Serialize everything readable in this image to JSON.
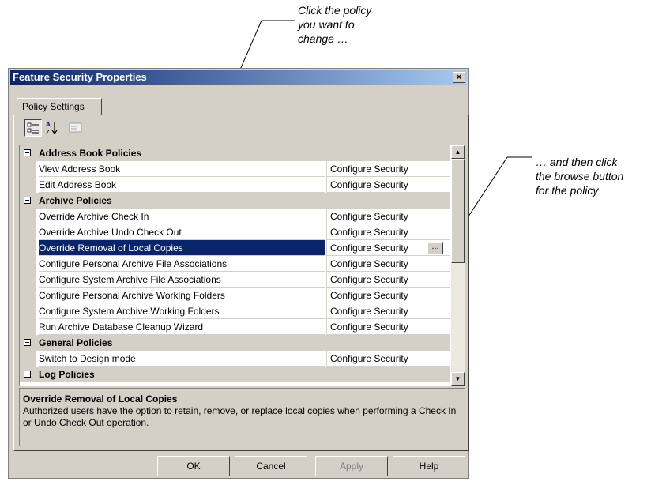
{
  "callouts": {
    "top": "Click the policy\nyou want to\nchange …",
    "right": "… and then click\nthe browse button\nfor the policy"
  },
  "window": {
    "title": "Feature Security Properties",
    "close": "×",
    "tab": "Policy Settings"
  },
  "toolbar": {
    "icons": [
      "categorized-icon",
      "alphabetical-sort-icon",
      "property-pages-icon"
    ],
    "alpha_glyph": "A Z"
  },
  "grid": {
    "rows": [
      {
        "type": "category",
        "name": "Address Book Policies"
      },
      {
        "type": "item",
        "name": "View Address Book",
        "value": "Configure Security"
      },
      {
        "type": "item",
        "name": "Edit Address Book",
        "value": "Configure Security"
      },
      {
        "type": "category",
        "name": "Archive Policies"
      },
      {
        "type": "item",
        "name": "Override Archive Check In",
        "value": "Configure Security"
      },
      {
        "type": "item",
        "name": "Override Archive Undo Check Out",
        "value": "Configure Security"
      },
      {
        "type": "item",
        "name": "Override Removal of Local Copies",
        "value": "Configure Security",
        "selected": true
      },
      {
        "type": "item",
        "name": "Configure Personal Archive File Associations",
        "value": "Configure Security"
      },
      {
        "type": "item",
        "name": "Configure System Archive File Associations",
        "value": "Configure Security"
      },
      {
        "type": "item",
        "name": "Configure Personal Archive Working Folders",
        "value": "Configure Security"
      },
      {
        "type": "item",
        "name": "Configure System Archive Working Folders",
        "value": "Configure Security"
      },
      {
        "type": "item",
        "name": "Run Archive Database Cleanup Wizard",
        "value": "Configure Security"
      },
      {
        "type": "category",
        "name": "General Policies"
      },
      {
        "type": "item",
        "name": "Switch to Design mode",
        "value": "Configure Security"
      },
      {
        "type": "category",
        "name": "Log Policies"
      }
    ],
    "browse_label": "...",
    "scroll_up": "▲",
    "scroll_down": "▼"
  },
  "description": {
    "title": "Override Removal of Local Copies",
    "text": "Authorized users have the option to retain, remove, or replace local copies when performing a Check In or Undo Check Out operation."
  },
  "buttons": {
    "ok": "OK",
    "cancel": "Cancel",
    "apply": "Apply",
    "help": "Help"
  },
  "colors": {
    "titlebar_start": "#0a246a",
    "titlebar_end": "#a6caf0",
    "selection": "#0a246a",
    "face": "#d4d0c8"
  }
}
